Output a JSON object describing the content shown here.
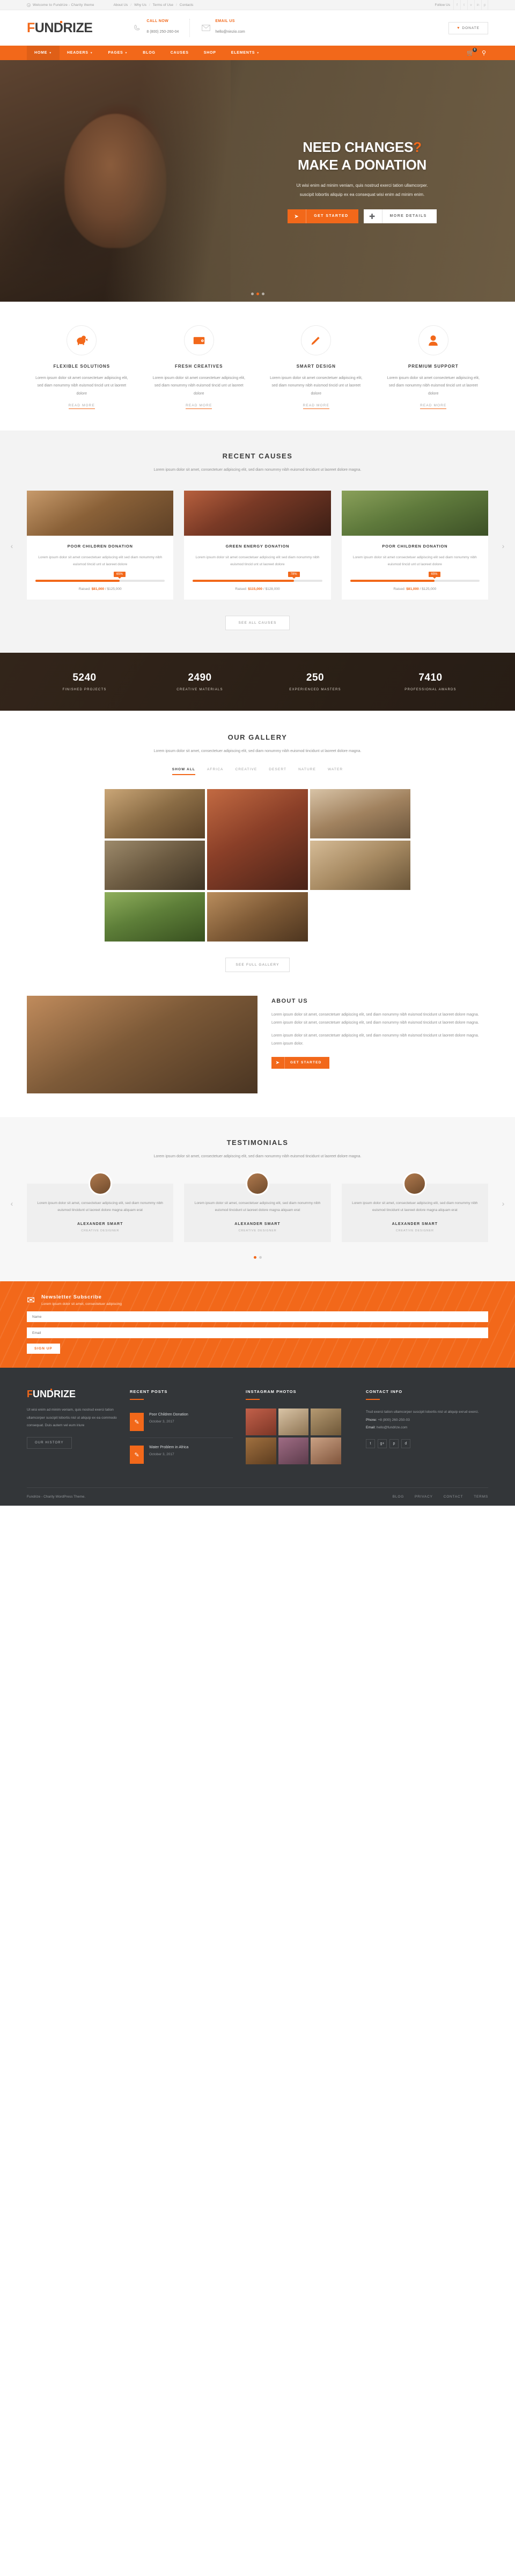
{
  "topbar": {
    "welcome": "Welcome to Fundrize - Charity theme",
    "links": [
      "About Us",
      "Why Us",
      "Terms of Use",
      "Contacts"
    ],
    "follow_label": "Follow Us",
    "social": [
      "f",
      "t",
      "v",
      "in",
      "p"
    ]
  },
  "header": {
    "logo_first": "F",
    "logo_rest": "UNDRIZE",
    "call_label": "CALL NOW",
    "call_value": "8 (800) 250-260-04",
    "email_label": "EMAIL US",
    "email_value": "hello@ninzio.com",
    "donate_label": "DONATE"
  },
  "nav": {
    "items": [
      {
        "label": "HOME",
        "caret": true
      },
      {
        "label": "HEADERS",
        "caret": true
      },
      {
        "label": "PAGES",
        "caret": true
      },
      {
        "label": "BLOG",
        "caret": false
      },
      {
        "label": "CAUSES",
        "caret": false
      },
      {
        "label": "SHOP",
        "caret": false
      },
      {
        "label": "ELEMENTS",
        "caret": true
      }
    ],
    "cart_count": "0"
  },
  "hero": {
    "line1": "NEED CHANGES",
    "qmark": "?",
    "line2": "MAKE A DONATION",
    "sub1": "Ut wisi enim ad minim veniam, quis nostrud exerci tation ullamcorper.",
    "sub2": "suscipit lobortis aliquip ex ea consequat wisi enim ad minim enim.",
    "btn_primary": "GET STARTED",
    "btn_secondary": "MORE DETAILS"
  },
  "features": [
    {
      "icon": "piggy-bank-icon",
      "glyph": "$",
      "title": "FLEXIBLE SOLUTIONS",
      "text": "Lorem ipsum dolor sit amet consectetuer adipiscing elit, sed diam nonummy nibh euismod tincid unt ut laoreet dolore",
      "more": "READ MORE"
    },
    {
      "icon": "wallet-icon",
      "glyph": "▬",
      "title": "FRESH CREATIVES",
      "text": "Lorem ipsum dolor sit amet consectetuer adipiscing elit, sed diam nonummy nibh euismod tincid unt ut laoreet dolore",
      "more": "READ MORE"
    },
    {
      "icon": "pencil-icon",
      "glyph": "✎",
      "title": "SMART DESIGN",
      "text": "Lorem ipsum dolor sit amet consectetuer adipiscing elit, sed diam nonummy nibh euismod tincid unt ut laoreet dolore",
      "more": "READ MORE"
    },
    {
      "icon": "user-icon",
      "glyph": "●",
      "title": "PREMIUM SUPPORT",
      "text": "Lorem ipsum dolor sit amet consectetuer adipiscing elit, sed diam nonummy nibh euismod tincid unt ut laoreet dolore",
      "more": "READ MORE"
    }
  ],
  "causes": {
    "title": "RECENT CAUSES",
    "desc": "Lorem ipsum dolor sit amet, consectetuer adipiscing elit, sed diam nonummy nibh euismod tincidunt ut laoreet dolore magna.",
    "cards": [
      {
        "title": "POOR CHILDREN DONATION",
        "text": "Lorem ipsum dolor sit amet consectetuer adipiscing elit sed diam nonummy nibh euismod tincid unt ut laoreet dolore",
        "percent": "65%",
        "pct": 65,
        "raised_label": "Raised:",
        "raised": "$81,000",
        "goal": "/ $125,000"
      },
      {
        "title": "GREEN ENERGY DONATION",
        "text": "Lorem ipsum dolor sit amet consectetuer adipiscing elit sed diam nonummy nibh euismod tincid unt ut laoreet dolore",
        "percent": "78%",
        "pct": 78,
        "raised_label": "Raised:",
        "raised": "$115,000",
        "goal": "/ $128,000"
      },
      {
        "title": "POOR CHILDREN DONATION",
        "text": "Lorem ipsum dolor sit amet consectetuer adipiscing elit sed diam nonummy nibh euismod tincid unt ut laoreet dolore",
        "percent": "65%",
        "pct": 65,
        "raised_label": "Raised:",
        "raised": "$81,000",
        "goal": "/ $125,000"
      }
    ],
    "see_all": "SEE ALL CAUSES"
  },
  "counters": [
    {
      "num": "5240",
      "label": "FINISHED PROJECTS"
    },
    {
      "num": "2490",
      "label": "CREATIVE MATERIALS"
    },
    {
      "num": "250",
      "label": "EXPERIENCED MASTERS"
    },
    {
      "num": "7410",
      "label": "PROFESSIONAL AWARDS"
    }
  ],
  "gallery": {
    "title": "OUR GALLERY",
    "desc": "Lorem ipsum dolor sit amet, consectetuer adipiscing elit, sed diam nonummy nibh euismod tincidunt ut laoreet dolore magna.",
    "filters": [
      "SHOW ALL",
      "AFRICA",
      "CREATIVE",
      "DESERT",
      "NATURE",
      "WATER"
    ],
    "active_filter": "SHOW ALL",
    "see_all": "SEE FULL GALLERY"
  },
  "about": {
    "title": "ABOUT US",
    "p1": "Lorem ipsum dolor sit amet, consectetuer adipiscing elit, sed diam nonummy nibh euismod tincidunt ut laoreet dolore magna. Lorem ipsum dolor sit amet, consectetuer adipiscing elit, sed diam nonummy nibh euismod tincidunt ut laoreet dolore magna.",
    "p2": "Lorem ipsum dolor sit amet, consectetuer adipiscing elit, sed diam nonummy nibh euismod tincidunt ut laoreet dolore magna. Lorem ipsum dolor.",
    "btn": "GET STARTED"
  },
  "testimonials": {
    "title": "TESTIMONIALS",
    "desc": "Lorem ipsum dolor sit amet, consectetuer adipiscing elit, sed diam nonummy nibh euismod tincidunt ut laoreet dolore magna.",
    "cards": [
      {
        "text": "Lorem ipsum dolor sit amet, consectetuer adipiscing elit, sed diam nonummy nibh euismod tincidunt ut laoreet dolore magna aliquam erat",
        "name": "ALEXANDER SMART",
        "role": "CREATIVE DESIGNER"
      },
      {
        "text": "Lorem ipsum dolor sit amet, consectetuer adipiscing elit, sed diam nonummy nibh euismod tincidunt ut laoreet dolore magna aliquam erat",
        "name": "ALEXANDER SMART",
        "role": "CREATIVE DESIGNER"
      },
      {
        "text": "Lorem ipsum dolor sit amet, consectetuer adipiscing elit, sed diam nonummy nibh euismod tincidunt ut laoreet dolore magna aliquam erat",
        "name": "ALEXANDER SMART",
        "role": "CREATIVE DESIGNER"
      }
    ]
  },
  "subscribe": {
    "title": "Newsletter Subscribe",
    "subtitle": "Lorem ipsum dolor sit amet, consectetuer adipiscing",
    "name_placeholder": "Name",
    "email_placeholder": "Email",
    "button": "SIGN UP"
  },
  "footer": {
    "logo_first": "F",
    "logo_rest": "UNDRIZE",
    "about": "Ut wisi enim ad minim veniam, quis nostrud exerci tation ullamcorper suscipit lobortis nisl ut aliquip ex ea commodo consequat. Duis autem vel eum iriure",
    "history_btn": "OUR HISTORY",
    "posts_title": "RECENT POSTS",
    "posts": [
      {
        "title": "Poor Children Donation",
        "date": "October 3, 2017"
      },
      {
        "title": "Water Problem in Africa",
        "date": "October 3, 2017"
      }
    ],
    "instagram_title": "INSTAGRAM PHOTOS",
    "contact_title": "CONTACT INFO",
    "contact_text": "Trud exerci tation ullamcorper suscipit lobortis nisl ut aliquip exrud exerci.",
    "phone_label": "Phone:",
    "phone": "+8 (800) 260-250-03",
    "email_label": "Email:",
    "email": "hello@fundrize.com",
    "social": [
      "t",
      "g+",
      "p",
      "d"
    ],
    "copyright": "Fundrize - Charity WordPress Theme.",
    "links": [
      "BLOG",
      "PRIVACY",
      "CONTACT",
      "TERMS"
    ]
  },
  "colors": {
    "accent": "#f2681a",
    "dark": "#333639"
  }
}
